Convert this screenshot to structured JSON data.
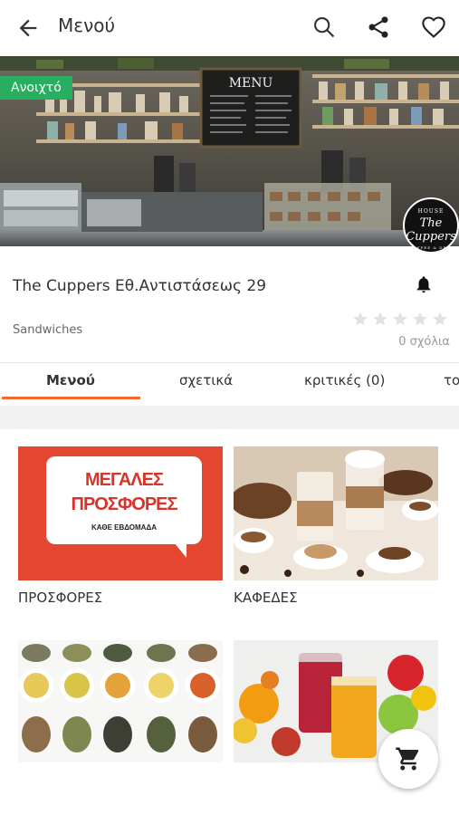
{
  "header": {
    "title": "Μενού"
  },
  "hero": {
    "status_badge": "Ανοιχτό",
    "chalkboard_text": "MENU"
  },
  "store": {
    "name": "The Cuppers Εθ.Αντιστάσεως 29",
    "category": "Sandwiches",
    "rating": 0,
    "rating_max": 5,
    "comments": "0 σχόλια"
  },
  "logo": {
    "text_top": "HOUSE",
    "text_main": "The Cuppers",
    "text_bottom": "COFFEE & DELI"
  },
  "tabs": [
    {
      "label": "Μενού",
      "active": true
    },
    {
      "label": "σχετικά",
      "active": false
    },
    {
      "label": "κριτικές (0)",
      "active": false
    },
    {
      "label": "τοπ",
      "active": false
    }
  ],
  "menu_categories": [
    {
      "label": "ΠΡΟΣΦΟΡΕΣ",
      "image_text": [
        "ΜΕΓΑΛΕΣ",
        "ΠΡΟΣΦΟΡΕΣ",
        "ΚΑΘΕ ΕΒΔΟΜΑΔΑ"
      ]
    },
    {
      "label": "ΚΑΦΕΔΕΣ"
    },
    {
      "label": ""
    },
    {
      "label": ""
    }
  ],
  "colors": {
    "accent": "#f26a2e",
    "open_badge": "#27ae60",
    "promo": "#e3472f"
  },
  "icons": [
    "back-arrow-icon",
    "search-icon",
    "share-icon",
    "heart-icon",
    "bell-icon",
    "star-icon",
    "cart-icon"
  ]
}
